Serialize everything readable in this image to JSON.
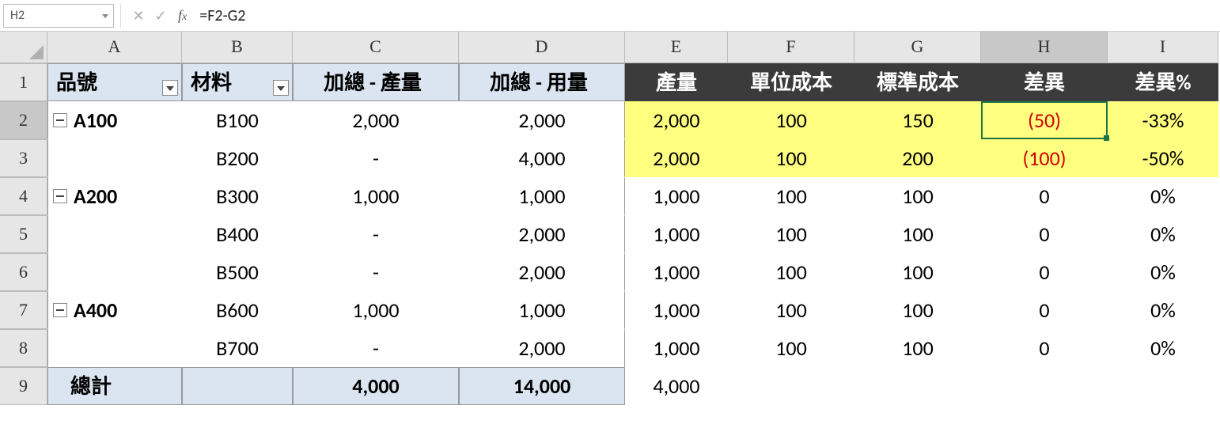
{
  "name_box": "H2",
  "formula": "=F2-G2",
  "columns": [
    "A",
    "B",
    "C",
    "D",
    "E",
    "F",
    "G",
    "H",
    "I"
  ],
  "selected_col": "H",
  "selected_row": "2",
  "rows": [
    "1",
    "2",
    "3",
    "4",
    "5",
    "6",
    "7",
    "8",
    "9"
  ],
  "pivot_headers": {
    "A": "品號",
    "B": "材料",
    "C": "加總 - 產量",
    "D": "加總 - 用量"
  },
  "dark_headers": {
    "E": "產量",
    "F": "單位成本",
    "G": "標準成本",
    "H": "差異",
    "I": "差異%"
  },
  "data": [
    {
      "a": "A100",
      "b": "B100",
      "c": "2,000",
      "d": "2,000",
      "e": "2,000",
      "f": "100",
      "g": "150",
      "h": "(50)",
      "i": "-33%",
      "hl": true,
      "neg": true,
      "group": true
    },
    {
      "a": "",
      "b": "B200",
      "c": "-",
      "d": "4,000",
      "e": "2,000",
      "f": "100",
      "g": "200",
      "h": "(100)",
      "i": "-50%",
      "hl": true,
      "neg": true,
      "group": false
    },
    {
      "a": "A200",
      "b": "B300",
      "c": "1,000",
      "d": "1,000",
      "e": "1,000",
      "f": "100",
      "g": "100",
      "h": "0",
      "i": "0%",
      "hl": false,
      "neg": false,
      "group": true
    },
    {
      "a": "",
      "b": "B400",
      "c": "-",
      "d": "2,000",
      "e": "1,000",
      "f": "100",
      "g": "100",
      "h": "0",
      "i": "0%",
      "hl": false,
      "neg": false,
      "group": false
    },
    {
      "a": "",
      "b": "B500",
      "c": "-",
      "d": "2,000",
      "e": "1,000",
      "f": "100",
      "g": "100",
      "h": "0",
      "i": "0%",
      "hl": false,
      "neg": false,
      "group": false
    },
    {
      "a": "A400",
      "b": "B600",
      "c": "1,000",
      "d": "1,000",
      "e": "1,000",
      "f": "100",
      "g": "100",
      "h": "0",
      "i": "0%",
      "hl": false,
      "neg": false,
      "group": true
    },
    {
      "a": "",
      "b": "B700",
      "c": "-",
      "d": "2,000",
      "e": "1,000",
      "f": "100",
      "g": "100",
      "h": "0",
      "i": "0%",
      "hl": false,
      "neg": false,
      "group": false
    }
  ],
  "totals": {
    "label": "總計",
    "c": "4,000",
    "d": "14,000",
    "e": "4,000"
  }
}
